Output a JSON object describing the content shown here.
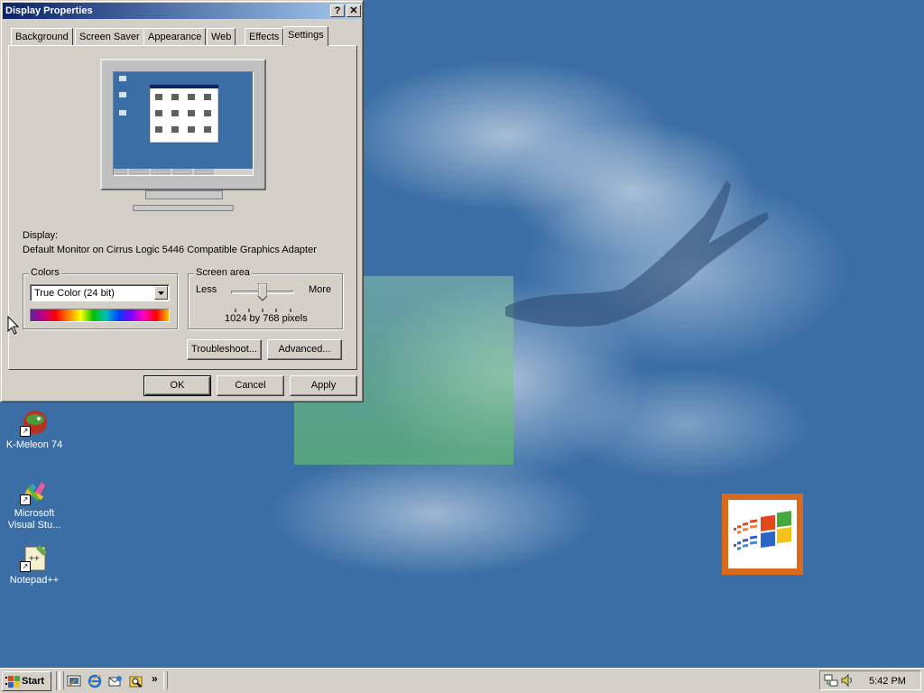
{
  "dialog": {
    "title": "Display Properties",
    "help_label": "?",
    "close_label": "✕",
    "tabs": [
      {
        "label": "Background"
      },
      {
        "label": "Screen Saver"
      },
      {
        "label": "Appearance"
      },
      {
        "label": "Web"
      },
      {
        "label": "Effects"
      },
      {
        "label": "Settings"
      }
    ],
    "display_label": "Display:",
    "display_value": "Default Monitor on Cirrus Logic 5446 Compatible Graphics Adapter",
    "colors": {
      "group_label": "Colors",
      "selected": "True Color (24 bit)"
    },
    "screen_area": {
      "group_label": "Screen area",
      "less_label": "Less",
      "more_label": "More",
      "resolution": "1024 by 768 pixels"
    },
    "buttons": {
      "troubleshoot": "Troubleshoot...",
      "advanced": "Advanced...",
      "ok": "OK",
      "cancel": "Cancel",
      "apply": "Apply"
    }
  },
  "desktop": {
    "icons": [
      {
        "label": "K-Meleon 74",
        "icon": "k-meleon-icon"
      },
      {
        "label": "Microsoft Visual Stu...",
        "icon": "visual-studio-icon"
      },
      {
        "label": "Notepad++",
        "icon": "notepad-plus-plus-icon"
      }
    ]
  },
  "taskbar": {
    "start_label": "Start",
    "quick_launch_more": "»",
    "clock": "5:42 PM"
  },
  "colors": {
    "desktop": "#3a6ea5",
    "title_start": "#0a246a",
    "title_end": "#a6caf0",
    "face": "#d4d0c8"
  }
}
